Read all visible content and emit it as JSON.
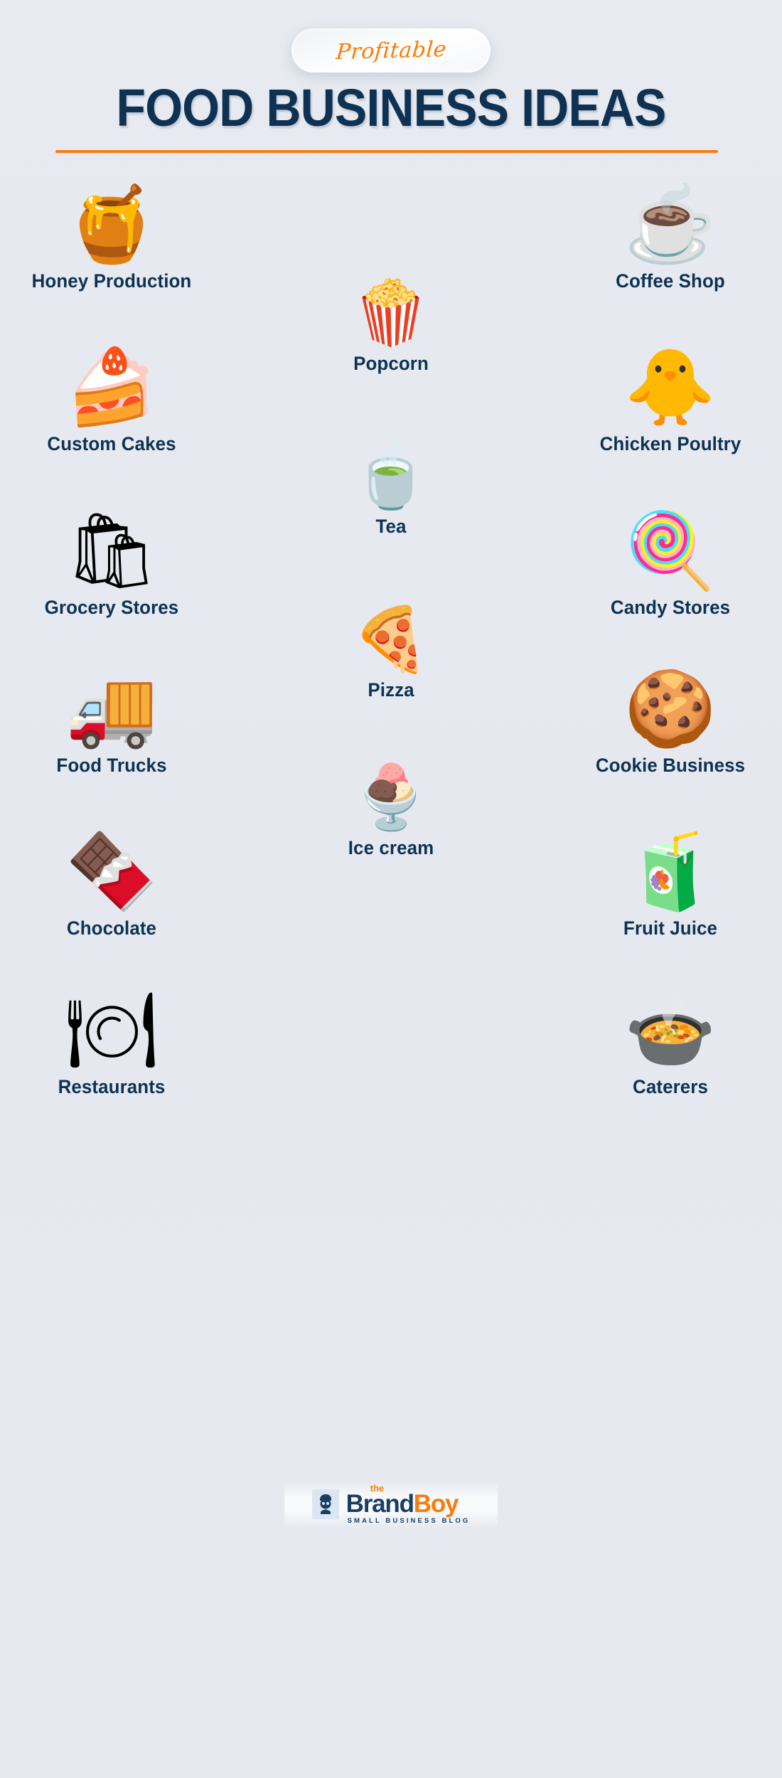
{
  "header": {
    "badge_label": "Profitable",
    "title": "FOOD BUSINESS IDEAS",
    "accent_color": "#f97b0c",
    "title_color": "#0f3252",
    "background_color": "#e6eaf0"
  },
  "items": [
    {
      "label": "Honey Production",
      "icon": "honeycomb-branch-icon",
      "glyph": "🍯",
      "column": "left",
      "row": 1
    },
    {
      "label": "Coffee Shop",
      "icon": "coffee-cup-icon",
      "glyph": "☕",
      "column": "right",
      "row": 1
    },
    {
      "label": "Popcorn",
      "icon": "popcorn-bucket-icon",
      "glyph": "🍿",
      "column": "center",
      "row": 1
    },
    {
      "label": "Custom Cakes",
      "icon": "strawberry-cake-icon",
      "glyph": "🍰",
      "column": "left",
      "row": 2
    },
    {
      "label": "Chicken Poultry",
      "icon": "baby-chick-icon",
      "glyph": "🐥",
      "column": "right",
      "row": 2
    },
    {
      "label": "Tea",
      "icon": "teacup-icon",
      "glyph": "🍵",
      "column": "center",
      "row": 2
    },
    {
      "label": "Grocery Stores",
      "icon": "grocery-bag-icon",
      "glyph": "🛍",
      "column": "left",
      "row": 3
    },
    {
      "label": "Candy Stores",
      "icon": "lollipop-icon",
      "glyph": "🍭",
      "column": "right",
      "row": 3
    },
    {
      "label": "Pizza",
      "icon": "pizza-slice-icon",
      "glyph": "🍕",
      "column": "center",
      "row": 3
    },
    {
      "label": "Food Trucks",
      "icon": "hot-dog-truck-icon",
      "glyph": "🚚",
      "column": "left",
      "row": 4
    },
    {
      "label": "Cookie Business",
      "icon": "cookie-stack-icon",
      "glyph": "🍪",
      "column": "right",
      "row": 4
    },
    {
      "label": "Ice cream",
      "icon": "ice-cream-cup-icon",
      "glyph": "🍨",
      "column": "center",
      "row": 4
    },
    {
      "label": "Chocolate",
      "icon": "chocolate-bar-icon",
      "glyph": "🍫",
      "column": "left",
      "row": 5
    },
    {
      "label": "Fruit Juice",
      "icon": "juice-glass-icon",
      "glyph": "🧃",
      "column": "right",
      "row": 5
    },
    {
      "label": "Restaurants",
      "icon": "dining-table-icon",
      "glyph": "🍽",
      "column": "left",
      "row": 6
    },
    {
      "label": "Caterers",
      "icon": "cloche-dome-icon",
      "glyph": "🍲",
      "column": "right",
      "row": 6
    }
  ],
  "logo": {
    "prefix": "the",
    "name_part1": "Brand",
    "name_part2": "Boy",
    "tagline": "SMALL BUSINESS BLOG",
    "mark": "boy-face-icon",
    "brand_navy": "#1c3d63",
    "brand_orange": "#f97b0c"
  }
}
